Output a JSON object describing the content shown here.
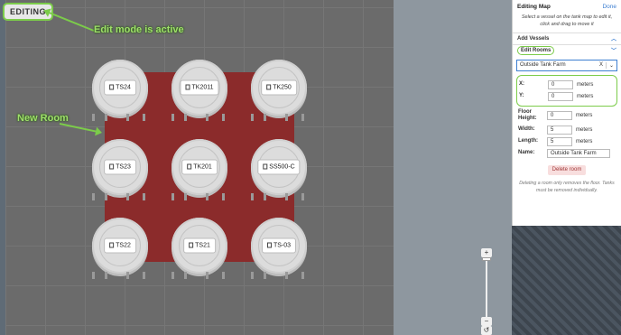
{
  "map": {
    "editing_badge": "EDITING",
    "annotation_edit_mode": "Edit mode is active",
    "annotation_new_room": "New Room",
    "tanks": [
      {
        "label": "TS24"
      },
      {
        "label": "TK2011"
      },
      {
        "label": "TK250"
      },
      {
        "label": "TS23"
      },
      {
        "label": "TK201"
      },
      {
        "label": "SS500-C"
      },
      {
        "label": "TS22"
      },
      {
        "label": "TS21"
      },
      {
        "label": "TS-03"
      }
    ],
    "zoom": {
      "in_label": "+",
      "out_label": "−",
      "reset_label": "↺"
    }
  },
  "panel": {
    "title": "Editing Map",
    "done_label": "Done",
    "instructions": "Select a vessel on the tank map to edit it, click and drag to move it",
    "add_vessels_label": "Add Vessels",
    "edit_rooms_label": "Edit Rooms",
    "room_select": {
      "value": "Outside Tank Farm",
      "clear": "X",
      "dropdown": "⌄"
    },
    "fields": {
      "x": {
        "label": "X:",
        "value": "0",
        "unit": "meters"
      },
      "y": {
        "label": "Y:",
        "value": "0",
        "unit": "meters"
      },
      "floor_height": {
        "label": "Floor Height:",
        "value": "0",
        "unit": "meters"
      },
      "width": {
        "label": "Width:",
        "value": "5",
        "unit": "meters"
      },
      "length": {
        "label": "Length:",
        "value": "5",
        "unit": "meters"
      },
      "name": {
        "label": "Name:",
        "value": "Outside Tank Farm"
      }
    },
    "delete_label": "Delete room",
    "note": "Deleting a room only removes the floor. Tanks must be removed individually."
  },
  "colors": {
    "accent": "#3d7fd1",
    "highlight": "#7ccc4a",
    "room": "#8b2b2b"
  }
}
